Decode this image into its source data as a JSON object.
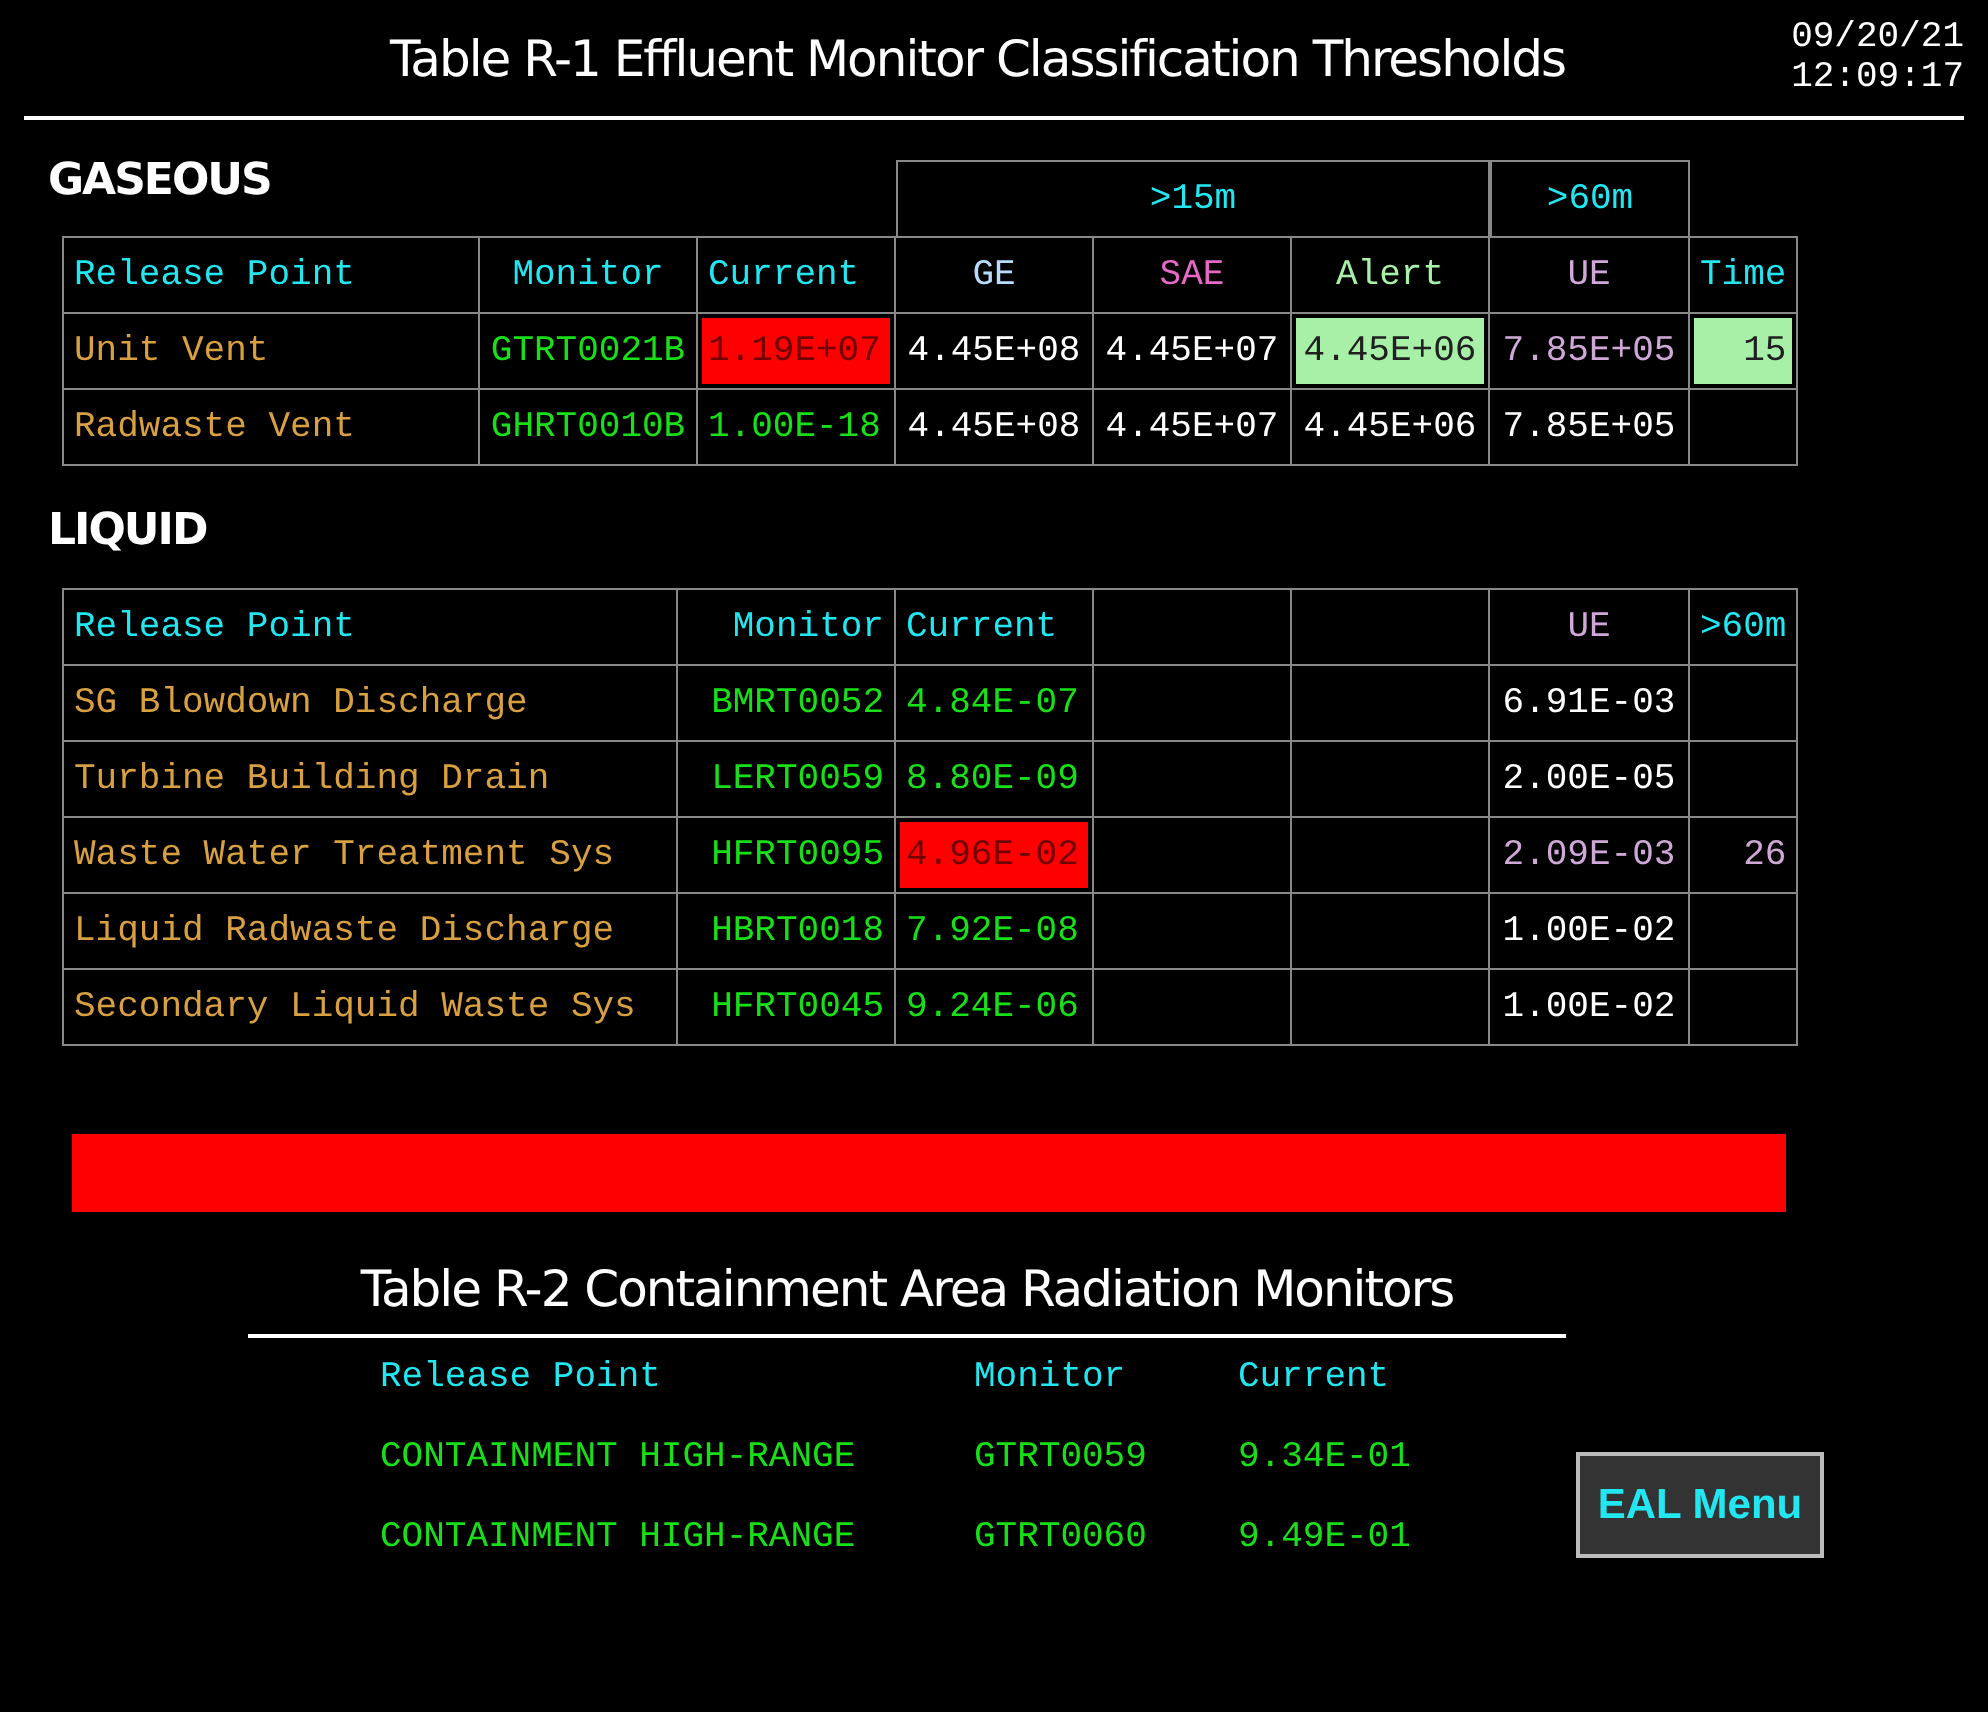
{
  "header": {
    "title": "Table R-1 Effluent Monitor Classification Thresholds",
    "date": "09/20/21",
    "time": "12:09:17"
  },
  "gaseous": {
    "label": "GASEOUS",
    "groups": [
      {
        "label": ">15m"
      },
      {
        "label": ">60m"
      }
    ],
    "columns": [
      {
        "label": "Release Point",
        "color": "#22e6f0"
      },
      {
        "label": "Monitor",
        "color": "#22e6f0"
      },
      {
        "label": "Current",
        "color": "#22e6f0"
      },
      {
        "label": "GE",
        "color": "#b8dcff"
      },
      {
        "label": "SAE",
        "color": "#e868c8"
      },
      {
        "label": "Alert",
        "color": "#a8f0a8"
      },
      {
        "label": "UE",
        "color": "#d0a8d8"
      },
      {
        "label": "Time",
        "color": "#22e6f0"
      }
    ],
    "rows": [
      [
        {
          "text": "Unit Vent",
          "color": "#d8a040",
          "kind": "plain"
        },
        {
          "text": "GTRT0021B",
          "color": "#18e018",
          "kind": "plain"
        },
        {
          "text": "1.19E+07",
          "kind": "alarm"
        },
        {
          "text": "4.45E+08",
          "color": "#ffffff",
          "kind": "plain"
        },
        {
          "text": "4.45E+07",
          "color": "#ffffff",
          "kind": "plain"
        },
        {
          "text": "4.45E+06",
          "kind": "alert"
        },
        {
          "text": "7.85E+05",
          "color": "#d0a8d8",
          "kind": "plain"
        },
        {
          "text": "15",
          "kind": "alert"
        }
      ],
      [
        {
          "text": "Radwaste Vent",
          "color": "#d8a040",
          "kind": "plain"
        },
        {
          "text": "GHRT0010B",
          "color": "#18e018",
          "kind": "plain"
        },
        {
          "text": "1.00E-18",
          "color": "#18e018",
          "kind": "plain"
        },
        {
          "text": "4.45E+08",
          "color": "#ffffff",
          "kind": "plain"
        },
        {
          "text": "4.45E+07",
          "color": "#ffffff",
          "kind": "plain"
        },
        {
          "text": "4.45E+06",
          "color": "#ffffff",
          "kind": "plain"
        },
        {
          "text": "7.85E+05",
          "color": "#ffffff",
          "kind": "plain"
        },
        null
      ]
    ]
  },
  "liquid": {
    "label": "LIQUID",
    "columns": [
      {
        "label": "Release Point",
        "color": "#22e6f0"
      },
      {
        "label": "Monitor",
        "color": "#22e6f0"
      },
      {
        "label": "Current",
        "color": "#22e6f0"
      },
      null,
      null,
      {
        "label": "UE",
        "color": "#d0a8d8"
      },
      {
        "label": ">60m",
        "color": "#22e6f0"
      }
    ],
    "rows": [
      [
        {
          "text": "SG Blowdown Discharge",
          "color": "#d8a040",
          "kind": "plain"
        },
        {
          "text": "BMRT0052",
          "color": "#18e018",
          "kind": "plain"
        },
        {
          "text": "4.84E-07",
          "color": "#18e018",
          "kind": "plain"
        },
        null,
        null,
        {
          "text": "6.91E-03",
          "color": "#ffffff",
          "kind": "plain"
        },
        null
      ],
      [
        {
          "text": "Turbine Building Drain",
          "color": "#d8a040",
          "kind": "plain"
        },
        {
          "text": "LERT0059",
          "color": "#18e018",
          "kind": "plain"
        },
        {
          "text": "8.80E-09",
          "color": "#18e018",
          "kind": "plain"
        },
        null,
        null,
        {
          "text": "2.00E-05",
          "color": "#ffffff",
          "kind": "plain"
        },
        null
      ],
      [
        {
          "text": "Waste Water Treatment Sys",
          "color": "#d8a040",
          "kind": "plain"
        },
        {
          "text": "HFRT0095",
          "color": "#18e018",
          "kind": "plain"
        },
        {
          "text": "4.96E-02",
          "kind": "alarm"
        },
        null,
        null,
        {
          "text": "2.09E-03",
          "color": "#d0a8d8",
          "kind": "plain"
        },
        {
          "text": "26",
          "color": "#d0a8d8",
          "kind": "plain"
        }
      ],
      [
        {
          "text": "Liquid Radwaste Discharge",
          "color": "#d8a040",
          "kind": "plain"
        },
        {
          "text": "HBRT0018",
          "color": "#18e018",
          "kind": "plain"
        },
        {
          "text": "7.92E-08",
          "color": "#18e018",
          "kind": "plain"
        },
        null,
        null,
        {
          "text": "1.00E-02",
          "color": "#ffffff",
          "kind": "plain"
        },
        null
      ],
      [
        {
          "text": "Secondary Liquid Waste Sys",
          "color": "#d8a040",
          "kind": "plain"
        },
        {
          "text": "HFRT0045",
          "color": "#18e018",
          "kind": "plain"
        },
        {
          "text": "9.24E-06",
          "color": "#18e018",
          "kind": "plain"
        },
        null,
        null,
        {
          "text": "1.00E-02",
          "color": "#ffffff",
          "kind": "plain"
        },
        null
      ]
    ]
  },
  "containment": {
    "title": "Table R-2 Containment Area Radiation Monitors",
    "columns": [
      "Release Point",
      "Monitor",
      "Current"
    ],
    "rows": [
      [
        "CONTAINMENT HIGH-RANGE",
        "GTRT0059",
        "9.34E-01"
      ],
      [
        "CONTAINMENT HIGH-RANGE",
        "GTRT0060",
        "9.49E-01"
      ]
    ]
  },
  "menu_button": {
    "label": "EAL Menu"
  }
}
